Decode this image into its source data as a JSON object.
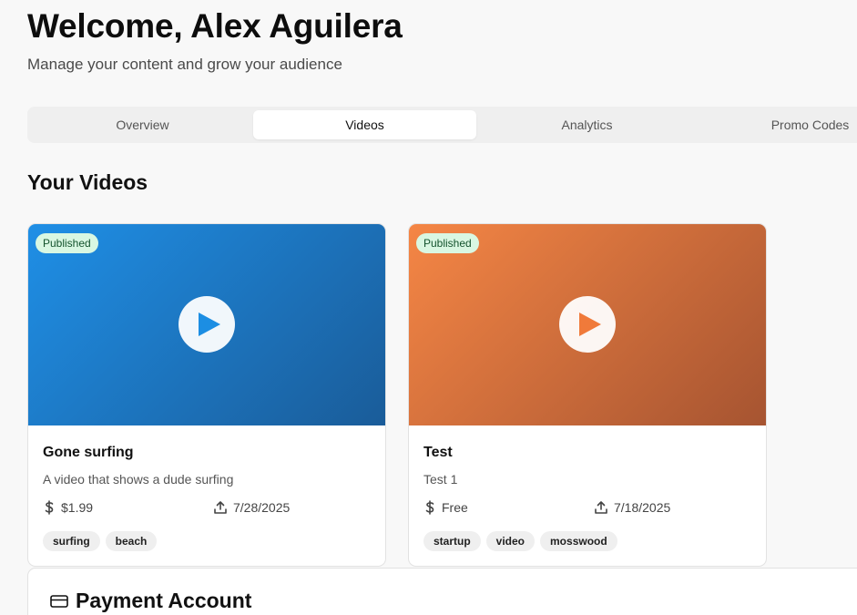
{
  "header": {
    "welcome": "Welcome, Alex Aguilera",
    "subtitle": "Manage your content and grow your audience"
  },
  "tabs": [
    {
      "label": "Overview",
      "active": false
    },
    {
      "label": "Videos",
      "active": true
    },
    {
      "label": "Analytics",
      "active": false
    },
    {
      "label": "Promo Codes",
      "active": false
    }
  ],
  "videos_section": {
    "title": "Your Videos",
    "videos": [
      {
        "status": "Published",
        "title": "Gone surfing",
        "description": "A video that shows a dude surfing",
        "price": "$1.99",
        "date": "7/28/2025",
        "tags": [
          "surfing",
          "beach"
        ],
        "gradient_start": "#1f8fe6",
        "gradient_end": "#1a5c99",
        "play_color": "#1c8ee3"
      },
      {
        "status": "Published",
        "title": "Test",
        "description": "Test 1",
        "price": "Free",
        "date": "7/18/2025",
        "tags": [
          "startup",
          "video",
          "mosswood"
        ],
        "gradient_start": "#f58645",
        "gradient_end": "#a65431",
        "play_color": "#f07a3a"
      }
    ]
  },
  "payment": {
    "title": "Payment Account"
  },
  "icons": {
    "price": "dollar-icon",
    "date": "upload-icon",
    "play": "play-icon",
    "payment": "credit-card-icon"
  }
}
